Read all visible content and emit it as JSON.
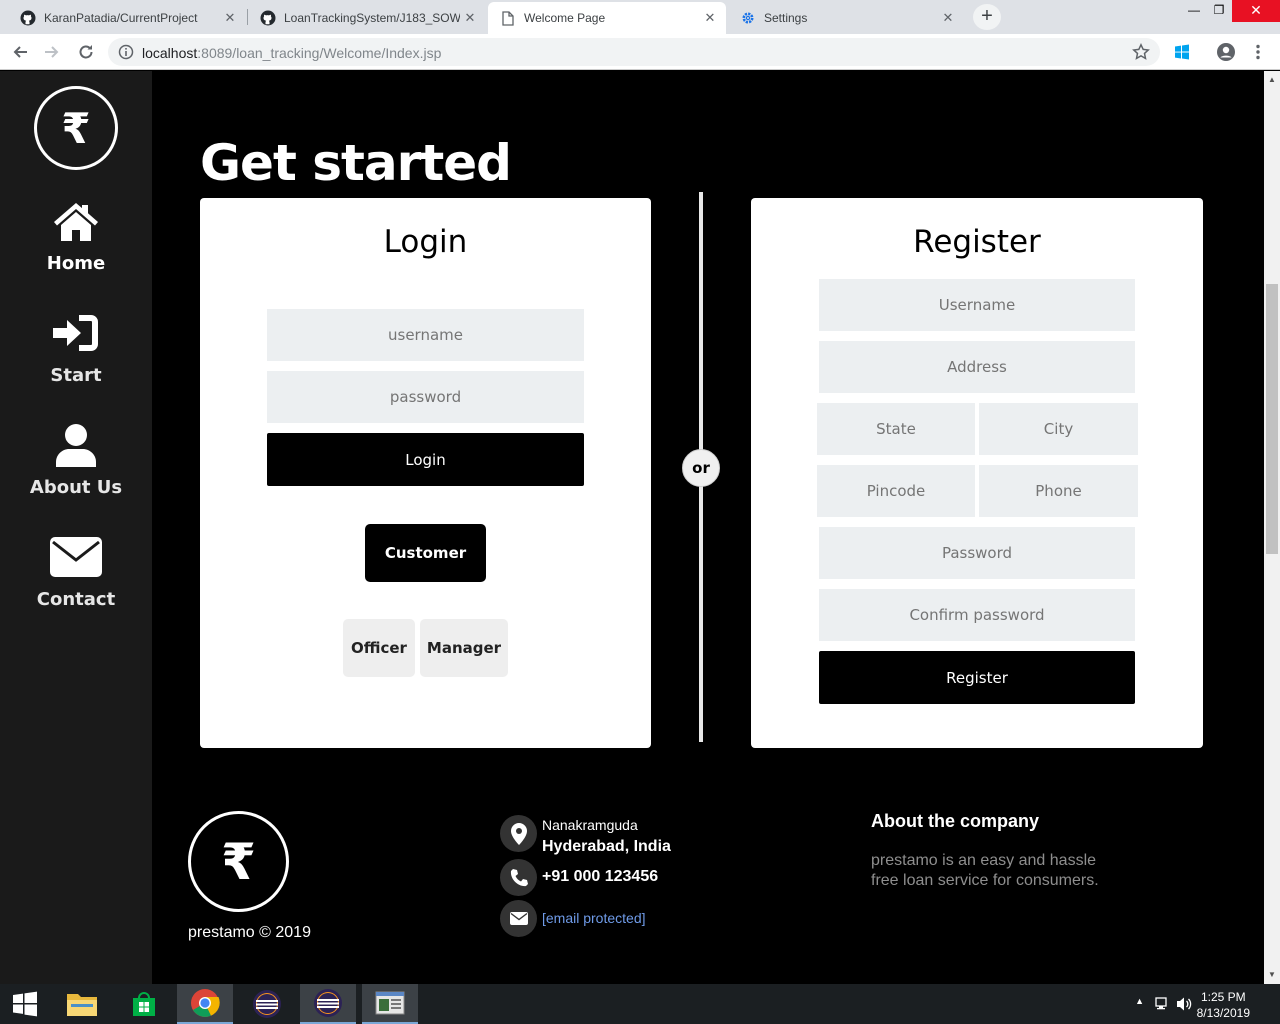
{
  "browser": {
    "tabs": [
      {
        "title": "KaranPatadia/CurrentProject",
        "icon": "github-icon"
      },
      {
        "title": "LoanTrackingSystem/J183_SOW",
        "icon": "github-icon"
      },
      {
        "title": "Welcome Page",
        "icon": "document-icon"
      },
      {
        "title": "Settings",
        "icon": "gear-icon"
      }
    ],
    "new_tab_label": "+",
    "url_host": "localhost",
    "url_rest": ":8089/loan_tracking/Welcome/Index.jsp"
  },
  "sidebar": {
    "logo_symbol": "₹",
    "items": [
      {
        "label": "Home",
        "icon": "home-icon"
      },
      {
        "label": "Start",
        "icon": "sign-in-icon"
      },
      {
        "label": "About Us",
        "icon": "user-icon"
      },
      {
        "label": "Contact",
        "icon": "envelope-icon"
      }
    ]
  },
  "main": {
    "title": "Get started",
    "divider_label": "or",
    "login": {
      "heading": "Login",
      "username_placeholder": "username",
      "password_placeholder": "password",
      "submit_label": "Login",
      "roles": {
        "customer": "Customer",
        "officer": "Officer",
        "manager": "Manager"
      },
      "selected_role": "Customer"
    },
    "register": {
      "heading": "Register",
      "username_placeholder": "Username",
      "address_placeholder": "Address",
      "state_placeholder": "State",
      "city_placeholder": "City",
      "pincode_placeholder": "Pincode",
      "phone_placeholder": "Phone",
      "password_placeholder": "Password",
      "confirm_placeholder": "Confirm password",
      "submit_label": "Register"
    }
  },
  "footer": {
    "logo_symbol": "₹",
    "copyright": "prestamo © 2019",
    "address_line1": "Nanakramguda",
    "address_line2": "Hyderabad, India",
    "phone": "+91 000 123456",
    "email": "[email protected]",
    "about_title": "About the company",
    "about_text": "prestamo is an easy and hassle free loan service for consumers."
  },
  "taskbar": {
    "time": "1:25 PM",
    "date": "8/13/2019"
  },
  "colors": {
    "sidebar_bg": "#1a1a1a",
    "page_bg": "#000000",
    "field_bg": "#eceff1",
    "link": "#6f9be8"
  }
}
